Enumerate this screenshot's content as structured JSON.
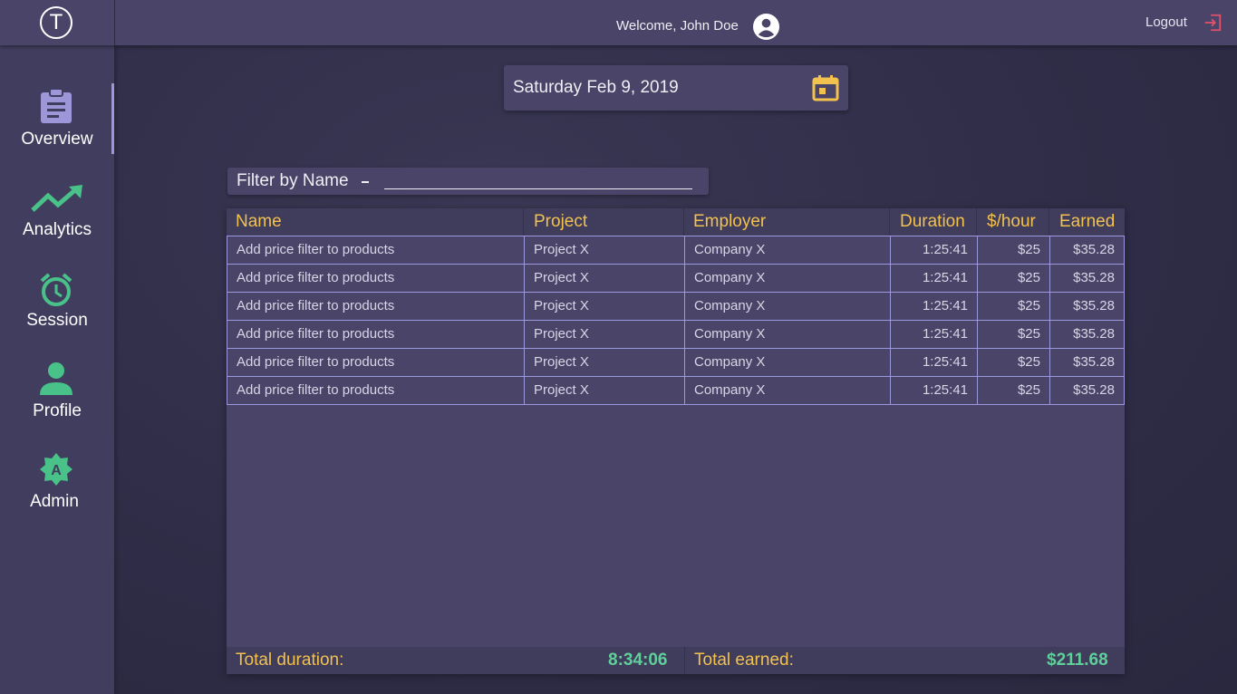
{
  "header": {
    "logo_letter": "T",
    "welcome": "Welcome, John Doe",
    "logout_label": "Logout"
  },
  "sidebar": {
    "items": [
      {
        "label": "Overview",
        "icon": "clipboard-icon",
        "color": "#9d97da",
        "active": true
      },
      {
        "label": "Analytics",
        "icon": "trending-up-icon",
        "color": "#49c28a",
        "active": false
      },
      {
        "label": "Session",
        "icon": "alarm-clock-icon",
        "color": "#49c28a",
        "active": false
      },
      {
        "label": "Profile",
        "icon": "person-icon",
        "color": "#49c28a",
        "active": false
      },
      {
        "label": "Admin",
        "icon": "admin-badge-icon",
        "badge_letter": "A",
        "color": "#49c28a",
        "active": false
      }
    ]
  },
  "date_picker": {
    "value": "Saturday Feb 9, 2019",
    "icon": "calendar-icon"
  },
  "filter": {
    "label": "Filter by Name",
    "value": ""
  },
  "table": {
    "columns": [
      "Name",
      "Project",
      "Employer",
      "Duration",
      "$/hour",
      "Earned"
    ],
    "rows": [
      [
        "Add price filter to products",
        "Project X",
        "Company X",
        "1:25:41",
        "$25",
        "$35.28"
      ],
      [
        "Add price filter to products",
        "Project X",
        "Company X",
        "1:25:41",
        "$25",
        "$35.28"
      ],
      [
        "Add price filter to products",
        "Project X",
        "Company X",
        "1:25:41",
        "$25",
        "$35.28"
      ],
      [
        "Add price filter to products",
        "Project X",
        "Company X",
        "1:25:41",
        "$25",
        "$35.28"
      ],
      [
        "Add price filter to products",
        "Project X",
        "Company X",
        "1:25:41",
        "$25",
        "$35.28"
      ],
      [
        "Add price filter to products",
        "Project X",
        "Company X",
        "1:25:41",
        "$25",
        "$35.28"
      ]
    ]
  },
  "totals": {
    "duration_label": "Total duration:",
    "duration_value": "8:34:06",
    "earned_label": "Total earned:",
    "earned_value": "$211.68"
  },
  "colors": {
    "accent_yellow": "#f2c14e",
    "accent_green": "#5fcf9b",
    "accent_purple": "#9d97da",
    "logout_red": "#e0506b"
  }
}
